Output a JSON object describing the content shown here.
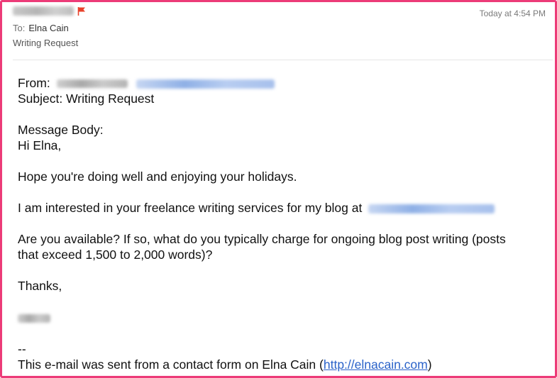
{
  "header": {
    "timestamp": "Today at 4:54 PM",
    "to_label": "To:",
    "to_name": "Elna Cain",
    "subject": "Writing Request",
    "flag_icon": "flag-icon",
    "flag_color": "#e8422b"
  },
  "body": {
    "from_label": "From:",
    "subject_line": "Subject: Writing Request",
    "message_body_label": "Message Body:",
    "greeting": "Hi Elna,",
    "para1": "Hope you're doing well and enjoying your holidays.",
    "para2": "I am interested in your freelance writing services for my blog at",
    "para3_line1": "Are you available? If so, what do you typically charge for ongoing blog post writing (posts",
    "para3_line2": "that exceed 1,500 to 2,000 words)?",
    "thanks": "Thanks,",
    "sig_separator": "--",
    "footer_text": "This e-mail was sent from a contact form on Elna Cain (",
    "footer_link": "http://elnacain.com",
    "footer_close": ")"
  },
  "colors": {
    "frame_border": "#ec3b78",
    "link": "#2a62c9"
  }
}
